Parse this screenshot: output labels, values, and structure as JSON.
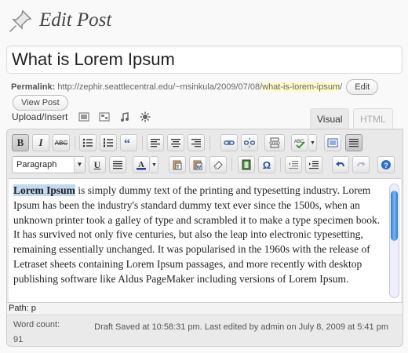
{
  "page": {
    "title": "Edit Post"
  },
  "post": {
    "title": "What is Lorem Ipsum"
  },
  "permalink": {
    "label": "Permalink:",
    "base": "http://zephir.seattlecentral.edu/~msinkula/2009/07/08/",
    "slug": "what-is-lorem-ipsum",
    "trail": "/",
    "edit_label": "Edit",
    "view_label": "View Post"
  },
  "upload": {
    "label": "Upload/Insert"
  },
  "tabs": {
    "visual": "Visual",
    "html": "HTML"
  },
  "toolbar": {
    "bold": "B",
    "italic": "I",
    "strike": "ABC",
    "format_value": "Paragraph",
    "underline": "U",
    "omega": "Ω",
    "colors": {
      "text_color_bar": "#2a3d9c",
      "accent": "#2a7bd8"
    }
  },
  "content": {
    "lead": "Lorem Ipsum",
    "body": " is simply dummy text of the printing and typesetting industry. Lorem Ipsum has been the industry's standard dummy text ever since the 1500s, when an unknown printer took a galley of type and scrambled it to make a type specimen book. It has survived not only five centuries, but also the leap into electronic typesetting, remaining essentially unchanged. It was popularised in the 1960s with the release of Letraset sheets containing Lorem Ipsum passages, and more recently with desktop publishing software like Aldus PageMaker including versions of Lorem Ipsum."
  },
  "path": {
    "text": "Path: p"
  },
  "status": {
    "word_count_label": "Word count:",
    "word_count": "91",
    "draft": "Draft Saved at 10:58:31 pm. Last edited by admin on July 8, 2009 at 5:41 pm"
  }
}
